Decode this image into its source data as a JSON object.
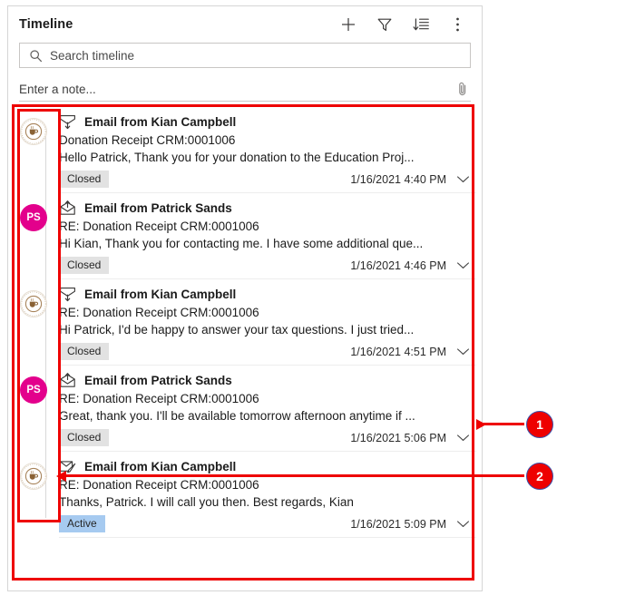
{
  "panel": {
    "title": "Timeline",
    "header_icons": [
      {
        "name": "add-icon",
        "label": "+"
      },
      {
        "name": "filter-icon",
        "label": "Filter"
      },
      {
        "name": "sort-icon",
        "label": "Sort"
      },
      {
        "name": "more-commands-icon",
        "label": "More commands"
      }
    ],
    "search": {
      "placeholder": "Search timeline",
      "value": "",
      "icon": "search-icon"
    },
    "note": {
      "placeholder": "Enter a note...",
      "value": "",
      "attach_icon": "paperclip-icon"
    }
  },
  "timeline": {
    "items": [
      {
        "icon": "email-received-icon",
        "avatar": {
          "type": "logo",
          "initials": "",
          "color": "#fdfcfa"
        },
        "title": "Email from Kian Campbell",
        "subject": "Donation Receipt CRM:0001006",
        "preview": "Hello Patrick,   Thank you for your donation to the Education Proj...",
        "status": "Closed",
        "status_kind": "closed",
        "time": "1/16/2021 4:40 PM",
        "chevron": "chevron-down-icon"
      },
      {
        "icon": "email-sent-icon",
        "avatar": {
          "type": "initials",
          "initials": "PS",
          "color": "#e3008c"
        },
        "title": "Email from Patrick Sands",
        "subject": "RE: Donation Receipt CRM:0001006",
        "preview": "Hi Kian, Thank you for contacting me. I have some additional que...",
        "status": "Closed",
        "status_kind": "closed",
        "time": "1/16/2021 4:46 PM",
        "chevron": "chevron-down-icon"
      },
      {
        "icon": "email-received-icon",
        "avatar": {
          "type": "logo",
          "initials": "",
          "color": "#fdfcfa"
        },
        "title": "Email from Kian Campbell",
        "subject": "RE: Donation Receipt CRM:0001006",
        "preview": "Hi Patrick,   I'd be happy to answer your tax questions. I just tried...",
        "status": "Closed",
        "status_kind": "closed",
        "time": "1/16/2021 4:51 PM",
        "chevron": "chevron-down-icon"
      },
      {
        "icon": "email-sent-icon",
        "avatar": {
          "type": "initials",
          "initials": "PS",
          "color": "#e3008c"
        },
        "title": "Email from Patrick Sands",
        "subject": "RE: Donation Receipt CRM:0001006",
        "preview": "Great, thank you. I'll be available tomorrow afternoon anytime if ...",
        "status": "Closed",
        "status_kind": "closed",
        "time": "1/16/2021 5:06 PM",
        "chevron": "chevron-down-icon"
      },
      {
        "icon": "email-draft-icon",
        "avatar": {
          "type": "logo",
          "initials": "",
          "color": "#fdfcfa"
        },
        "title": "Email from Kian Campbell",
        "subject": "RE: Donation Receipt CRM:0001006",
        "preview": "Thanks, Patrick. I will call you then.   Best regards, Kian",
        "status": "Active",
        "status_kind": "active",
        "time": "1/16/2021 5:09 PM",
        "chevron": "chevron-down-icon"
      }
    ]
  },
  "annotations": {
    "color": "#ee0000",
    "callouts": [
      {
        "number": "1",
        "target": "timeline-records-area"
      },
      {
        "number": "2",
        "target": "timeline-avatar-column"
      }
    ]
  }
}
